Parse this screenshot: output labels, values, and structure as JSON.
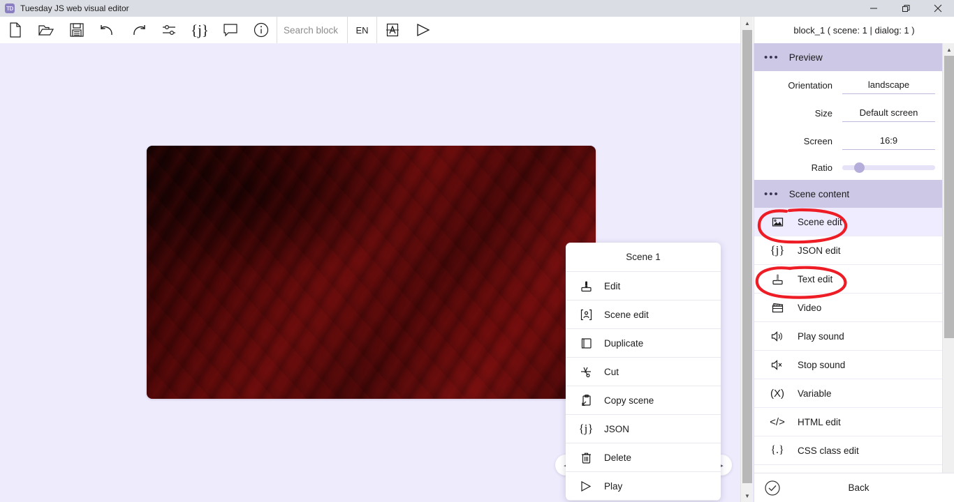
{
  "window": {
    "title": "Tuesday JS web visual editor",
    "app_icon": "app-logo-icon",
    "logo_text": "TD",
    "minimize": "minimize-icon",
    "maximize": "maximize-icon",
    "close": "close-icon"
  },
  "toolbar": {
    "tools": [
      {
        "name": "new-file-icon",
        "title": "New"
      },
      {
        "name": "open-folder-icon",
        "title": "Open"
      },
      {
        "name": "save-icon",
        "title": "Save"
      },
      {
        "name": "undo-icon",
        "title": "Undo"
      },
      {
        "name": "redo-icon",
        "title": "Redo"
      },
      {
        "name": "settings-sliders-icon",
        "title": "Settings"
      },
      {
        "name": "json-braces-icon",
        "title": "JSON"
      },
      {
        "name": "comment-icon",
        "title": "Comment"
      },
      {
        "name": "info-icon",
        "title": "Info"
      }
    ],
    "search_placeholder": "Search block",
    "search_value": "",
    "language": "EN",
    "font_button": "font-icon",
    "play_button": "play-icon"
  },
  "canvas": {
    "scene_thumbnail_alt": "dark red marble scene background"
  },
  "context_menu": {
    "title": "Scene 1",
    "items": [
      {
        "icon": "edit-stamp-icon",
        "label": "Edit"
      },
      {
        "icon": "scene-edit-icon",
        "label": "Scene edit"
      },
      {
        "icon": "duplicate-icon",
        "label": "Duplicate"
      },
      {
        "icon": "cut-scissors-icon",
        "label": "Cut"
      },
      {
        "icon": "copy-scene-icon",
        "label": "Copy scene"
      },
      {
        "icon": "json-braces-icon",
        "label": "JSON"
      },
      {
        "icon": "trash-icon",
        "label": "Delete"
      },
      {
        "icon": "play-icon",
        "label": "Play"
      }
    ],
    "nav_prev": "◂",
    "nav_next": "▸"
  },
  "right_panel": {
    "header": "block_1 ( scene: 1 | dialog: 1 )",
    "preview": {
      "section_title": "Preview",
      "dots": "• • •",
      "fields": [
        {
          "label": "Orientation",
          "value": "landscape"
        },
        {
          "label": "Size",
          "value": "Default screen"
        },
        {
          "label": "Screen",
          "value": "16:9"
        }
      ],
      "ratio_label": "Ratio",
      "ratio_value": 18
    },
    "scene_content": {
      "section_title": "Scene content",
      "items": [
        {
          "icon": "scene-image-icon",
          "label": "Scene edit",
          "active": true
        },
        {
          "icon": "json-braces-icon",
          "label": "JSON edit",
          "active": false
        },
        {
          "icon": "text-edit-stamp-icon",
          "label": "Text edit",
          "active": false
        },
        {
          "icon": "video-clapper-icon",
          "label": "Video",
          "active": false
        },
        {
          "icon": "speaker-on-icon",
          "label": "Play sound",
          "active": false
        },
        {
          "icon": "speaker-mute-icon",
          "label": "Stop sound",
          "active": false
        },
        {
          "icon": "variable-x-icon",
          "label": "Variable",
          "active": false
        },
        {
          "icon": "html-code-icon",
          "label": "HTML edit",
          "active": false
        },
        {
          "icon": "css-braces-icon",
          "label": "CSS class edit",
          "active": false
        }
      ]
    },
    "footer": {
      "confirm_icon": "check-circle-icon",
      "back_label": "Back"
    }
  },
  "annotations": {
    "color": "#ee1c24",
    "marks": [
      {
        "name": "circle-around-scene-edit",
        "target": "Scene edit"
      },
      {
        "name": "circle-around-text-edit",
        "target": "Text edit"
      }
    ]
  }
}
